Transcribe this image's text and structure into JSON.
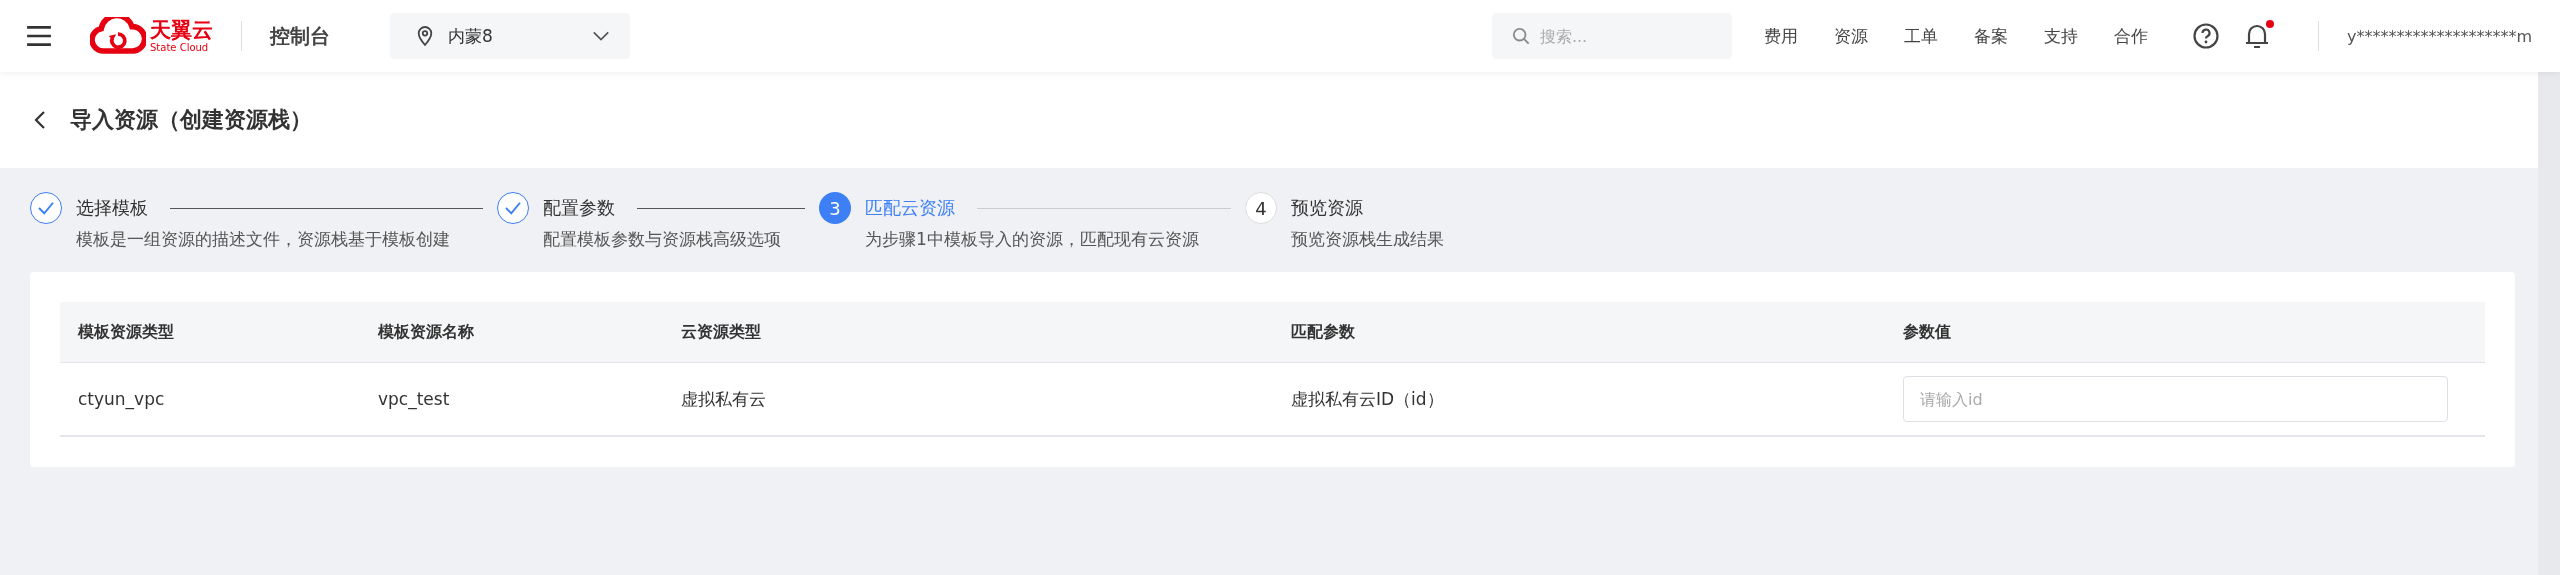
{
  "topbar": {
    "brand": {
      "name": "天翼云",
      "sub": "State Cloud"
    },
    "console": "控制台",
    "region": "内蒙8",
    "search": {
      "placeholder": "搜索..."
    },
    "nav": [
      "费用",
      "资源",
      "工单",
      "备案",
      "支持",
      "合作"
    ],
    "notifications": {
      "unread": true
    },
    "user": "y********************m"
  },
  "page": {
    "title": "导入资源（创建资源栈）"
  },
  "steps": [
    {
      "completed": true,
      "selected": false,
      "title": "选择模板",
      "description": "模板是一组资源的描述文件，资源栈基于模板创建"
    },
    {
      "completed": true,
      "selected": false,
      "title": "配置参数",
      "description": "配置模板参数与资源栈高级选项"
    },
    {
      "completed": false,
      "selected": true,
      "number": "3",
      "title": "匹配云资源",
      "description": "为步骤1中模板导入的资源，匹配现有云资源"
    },
    {
      "completed": false,
      "selected": false,
      "number": "4",
      "title": "预览资源",
      "description": "预览资源栈生成结果"
    }
  ],
  "table": {
    "columns": [
      "模板资源类型",
      "模板资源名称",
      "云资源类型",
      "匹配参数",
      "参数值"
    ],
    "rows": [
      {
        "cells": [
          "ctyun_vpc",
          "vpc_test",
          "虚拟私有云",
          "虚拟私有云ID（id）"
        ],
        "input": {
          "placeholder": "请输入id"
        }
      }
    ]
  }
}
